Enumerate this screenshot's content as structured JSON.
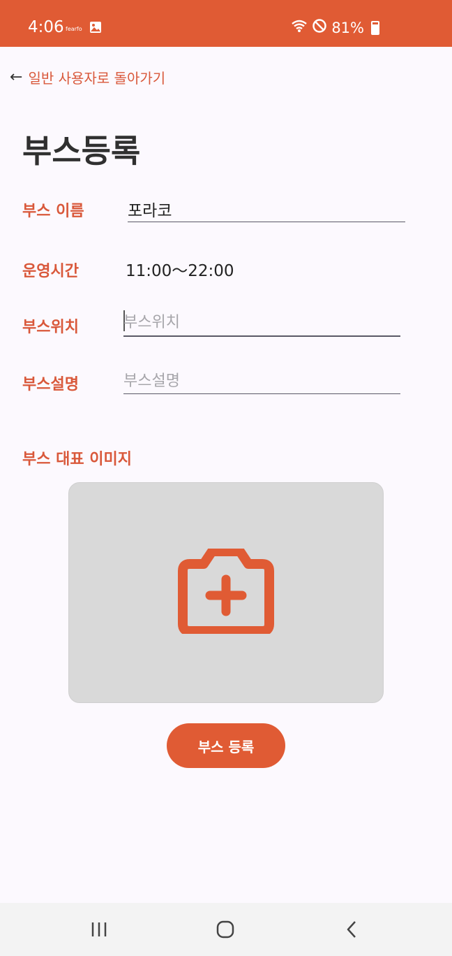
{
  "status_bar": {
    "time": "4:06",
    "small_label": "fearfo",
    "battery": "81%",
    "icons": [
      "image-icon",
      "wifi-icon",
      "do-not-disturb-icon",
      "battery-icon"
    ]
  },
  "header": {
    "back_label": "일반 사용자로 돌아가기",
    "title": "부스등록"
  },
  "form": {
    "name_label": "부스 이름",
    "name_value": "포라코",
    "hours_label": "운영시간",
    "hours_value": "11:00～22:00",
    "location_label": "부스위치",
    "location_placeholder": "부스위치",
    "description_label": "부스설명",
    "description_placeholder": "부스설명",
    "image_label": "부스 대표 이미지"
  },
  "actions": {
    "submit_label": "부스 등록"
  },
  "colors": {
    "accent": "#e05b34",
    "label": "#d9583a",
    "background": "#fcf9fe",
    "image_placeholder_bg": "#d9d9d9"
  },
  "nav": {
    "icons": [
      "recent-apps-icon",
      "home-icon",
      "back-icon"
    ]
  }
}
